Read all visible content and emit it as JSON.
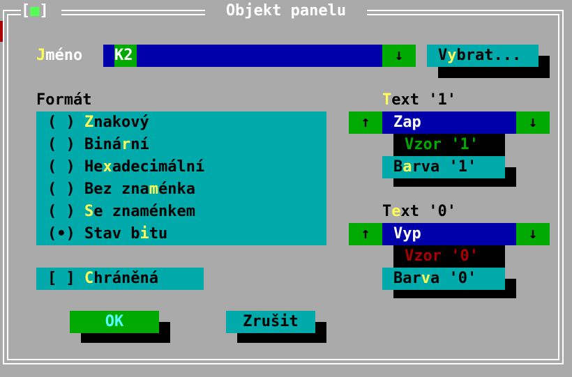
{
  "dialog": {
    "title": "Objekt panelu",
    "close_glyph": "■",
    "close_left": "[",
    "close_right": "]"
  },
  "name": {
    "label_hot": "J",
    "label_rest": "méno",
    "value": "K2",
    "dropdown_glyph": "↓",
    "select_pre": "V",
    "select_hot": "y",
    "select_post": "brat..."
  },
  "format": {
    "title": "Formát",
    "options": [
      {
        "mark": "( )",
        "pre": "",
        "hot": "Z",
        "post": "nakový"
      },
      {
        "mark": "( )",
        "pre": "Biná",
        "hot": "r",
        "post": "ní"
      },
      {
        "mark": "( )",
        "pre": "He",
        "hot": "x",
        "post": "adecimální"
      },
      {
        "mark": "( )",
        "pre": "Bez zna",
        "hot": "m",
        "post": "énka"
      },
      {
        "mark": "( )",
        "pre": "",
        "hot": "S",
        "post": "e znaménkem"
      },
      {
        "mark": "(•)",
        "pre": "Stav b",
        "hot": "i",
        "post": "tu"
      }
    ]
  },
  "protected": {
    "mark": "[ ]",
    "hot": "C",
    "rest": "hráněná"
  },
  "text1": {
    "label_hot": "T",
    "label_rest": "ext '1'",
    "up_glyph": "↑",
    "down_glyph": "↓",
    "value": "Zap",
    "sample": "Vzor '1'",
    "color_pre": "B",
    "color_hot": "a",
    "color_post": "rva '1'"
  },
  "text0": {
    "label_pre": "T",
    "label_hot": "e",
    "label_post": "xt '0'",
    "up_glyph": "↑",
    "down_glyph": "↓",
    "value": "Vyp",
    "sample": "Vzor '0'",
    "color_pre": "Bar",
    "color_hot": "v",
    "color_post": "a '0'"
  },
  "buttons": {
    "ok": "OK",
    "cancel": "Zrušit"
  },
  "colors": {
    "background": "#aaaaaa",
    "cyan": "#00aaaa",
    "blue": "#0000aa",
    "green": "#00aa00",
    "hotkey": "#ffff55",
    "sample1": "#00aa00",
    "sample0": "#aa0000"
  }
}
